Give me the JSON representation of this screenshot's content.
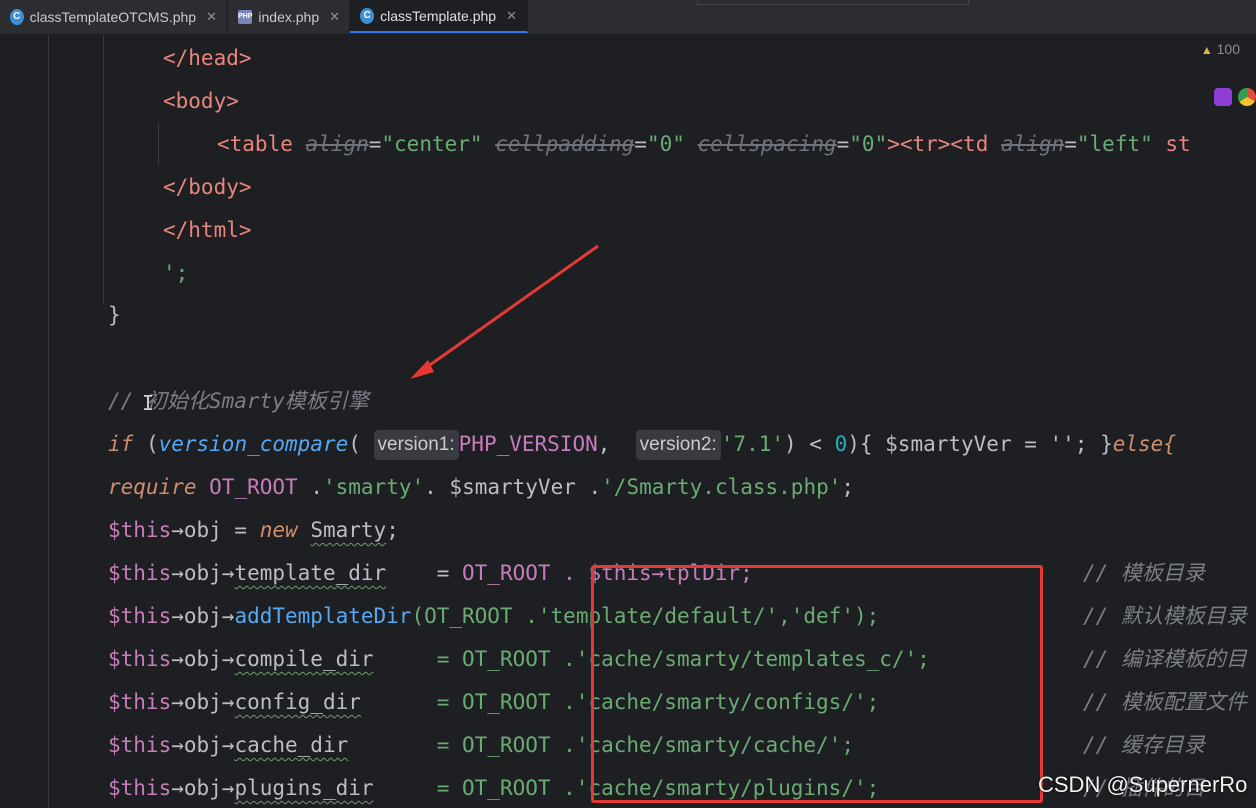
{
  "tabs": [
    {
      "label": "classTemplateOTCMS.php",
      "icon": "php-class-icon",
      "active": false
    },
    {
      "label": "index.php",
      "icon": "php-file-icon",
      "active": false
    },
    {
      "label": "classTemplate.php",
      "icon": "php-class-icon",
      "active": true
    }
  ],
  "inspections": {
    "count": "100"
  },
  "code": {
    "head_close": "</head>",
    "body_open": "<body>",
    "table_line": {
      "tag": "<table",
      "a1": "align",
      "v1": "\"center\"",
      "a2": "cellpadding",
      "v2": "\"0\"",
      "a3": "cellspacing",
      "v3": "\"0\"",
      "tail_tr": "><tr><td",
      "a4": "align",
      "v4": "\"left\"",
      "trail": "st"
    },
    "body_close": "</body>",
    "html_close": "</html>",
    "quote_end": "';",
    "brace": "}",
    "comment_init": "// 初始化Smarty模板引擎",
    "if_kw": "if",
    "if_fn": "version_compare",
    "hint1": "version1:",
    "if_arg1": "PHP_VERSION",
    "hint2": "version2:",
    "if_arg2": "'7.1'",
    "if_rest1": ") < ",
    "if_num": "0",
    "if_rest2": "){ $smartyVer = ''; }",
    "if_else": "else{",
    "req_kw": "require",
    "req_const": "OT_ROOT",
    "req_str1": "'smarty'",
    "req_mid": ". $smartyVer .",
    "req_str2": "'/Smarty.class.php'",
    "new_var": "$this",
    "new_obj": "→obj = ",
    "new_kw": "new",
    "new_cls": "Smarty",
    "assign_lines": [
      {
        "prop": "template_dir",
        "val": "OT_ROOT . $this→tplDir;",
        "comment": "// 模板目录"
      },
      {
        "prop": "addTemplateDir",
        "val": "(OT_ROOT .'template/default/','def');",
        "comment": "// 默认模板目录"
      },
      {
        "prop": "compile_dir",
        "val": "= OT_ROOT .'cache/smarty/templates_c/';",
        "comment": "// 编译模板的目"
      },
      {
        "prop": "config_dir",
        "val": "= OT_ROOT .'cache/smarty/configs/';",
        "comment": "// 模板配置文件"
      },
      {
        "prop": "cache_dir",
        "val": "= OT_ROOT .'cache/smarty/cache/';",
        "comment": "// 缓存目录"
      },
      {
        "prop": "plugins_dir",
        "val": "= OT_ROOT .'cache/smarty/plugins/';",
        "comment": "// 插件的目"
      }
    ]
  },
  "watermark": "CSDN @SupernerRo",
  "colors": {
    "annotation": "#e53935",
    "editor_bg": "#1e1f22"
  }
}
